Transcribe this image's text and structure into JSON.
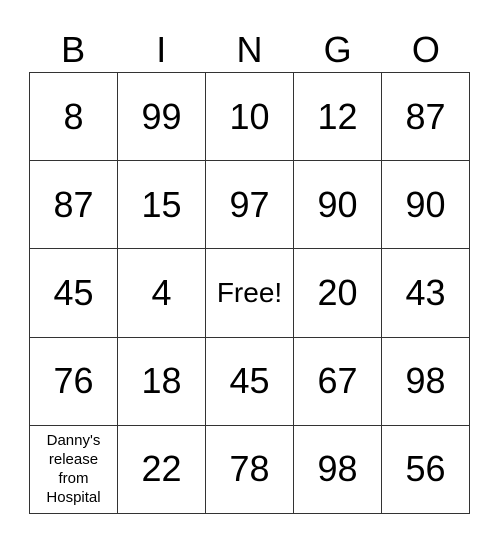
{
  "header": [
    "B",
    "I",
    "N",
    "G",
    "O"
  ],
  "rows": [
    [
      "8",
      "99",
      "10",
      "12",
      "87"
    ],
    [
      "87",
      "15",
      "97",
      "90",
      "90"
    ],
    [
      "45",
      "4",
      "Free!",
      "20",
      "43"
    ],
    [
      "76",
      "18",
      "45",
      "67",
      "98"
    ],
    [
      "Danny's\nrelease\nfrom\nHospital",
      "22",
      "78",
      "98",
      "56"
    ]
  ]
}
